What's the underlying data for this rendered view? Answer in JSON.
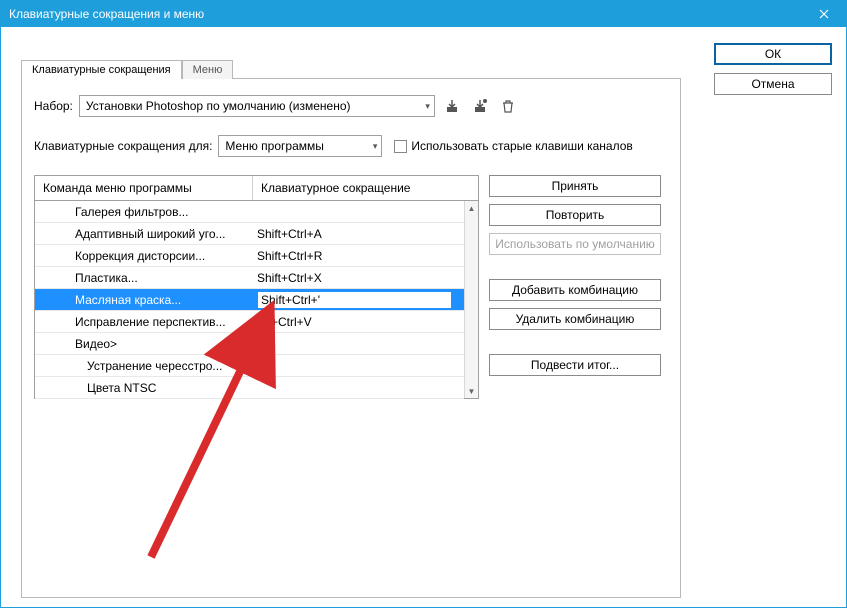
{
  "title": "Клавиатурные сокращения и меню",
  "buttons": {
    "ok": "ОК",
    "cancel": "Отмена",
    "accept": "Принять",
    "repeat": "Повторить",
    "use_default": "Использовать по умолчанию",
    "add_combo": "Добавить комбинацию",
    "delete_combo": "Удалить комбинацию",
    "summarize": "Подвести итог..."
  },
  "tabs": {
    "shortcuts": "Клавиатурные сокращения",
    "menu": "Меню"
  },
  "set_row": {
    "label": "Набор:",
    "value": "Установки Photoshop по умолчанию (изменено)"
  },
  "for_row": {
    "label": "Клавиатурные сокращения для:",
    "value": "Меню программы",
    "checkbox_label": "Использовать старые клавиши каналов"
  },
  "table": {
    "head1": "Команда меню программы",
    "head2": "Клавиатурное сокращение",
    "rows": [
      {
        "cmd": "Галерея фильтров...",
        "key": "",
        "indent": 1
      },
      {
        "cmd": "Адаптивный широкий уго...",
        "key": "Shift+Ctrl+A",
        "indent": 1
      },
      {
        "cmd": "Коррекция дисторсии...",
        "key": "Shift+Ctrl+R",
        "indent": 1
      },
      {
        "cmd": "Пластика...",
        "key": "Shift+Ctrl+X",
        "indent": 1
      },
      {
        "cmd": "Масляная краска...",
        "key": "Shift+Ctrl+'",
        "indent": 1,
        "selected": true,
        "editing": true
      },
      {
        "cmd": "Исправление перспектив...",
        "key": "Alt+Ctrl+V",
        "indent": 1
      },
      {
        "cmd": "Видео>",
        "key": "",
        "indent": 1
      },
      {
        "cmd": "Устранение чересстро...",
        "key": "",
        "indent": 2
      },
      {
        "cmd": "Цвета NTSC",
        "key": "",
        "indent": 2
      }
    ]
  }
}
